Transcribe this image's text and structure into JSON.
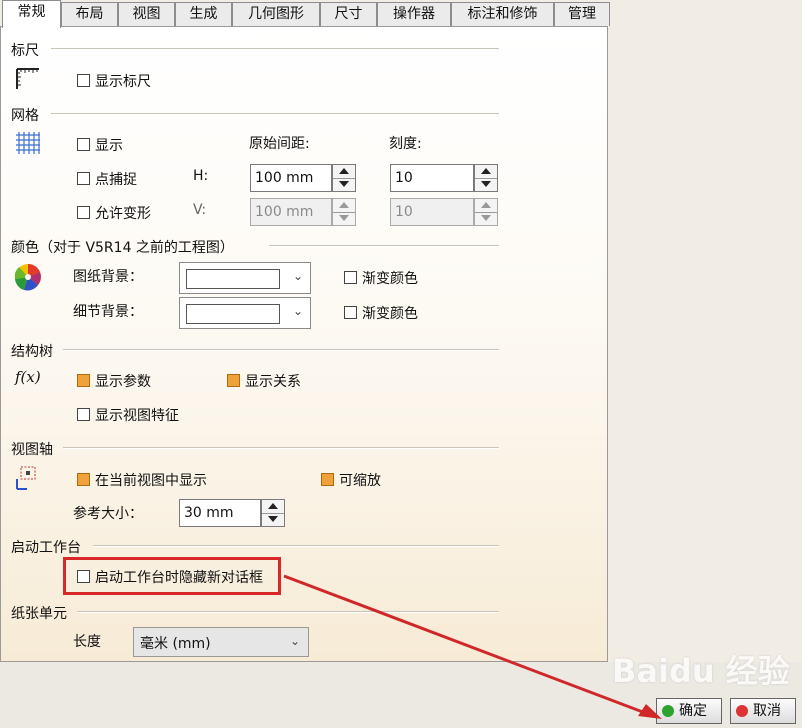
{
  "tabs": [
    "常规",
    "布局",
    "视图",
    "生成",
    "几何图形",
    "尺寸",
    "操作器",
    "标注和修饰",
    "管理"
  ],
  "ruler": {
    "section": "标尺",
    "show_label": "显示标尺",
    "show_checked": false
  },
  "grid": {
    "section": "网格",
    "show_label": "显示",
    "snap_label": "点捕捉",
    "allow_deform_label": "允许变形",
    "spacing_header": "原始间距:",
    "graduation_header": "刻度:",
    "h_label": "H:",
    "v_label": "V:",
    "h_spacing": "100 mm",
    "v_spacing": "100 mm",
    "h_graduation": "10",
    "v_graduation": "10"
  },
  "colors": {
    "section": "颜色（对于 V5R14 之前的工程图）",
    "sheet_bg_label": "图纸背景：",
    "detail_bg_label": "细节背景：",
    "gradient_label": "渐变颜色"
  },
  "tree": {
    "section": "结构树",
    "show_params_label": "显示参数",
    "show_relations_label": "显示关系",
    "show_view_features_label": "显示视图特征",
    "icon_text": "f(x)"
  },
  "view_axis": {
    "section": "视图轴",
    "show_in_current_label": "在当前视图中显示",
    "zoomable_label": "可缩放",
    "ref_size_label": "参考大小：",
    "ref_size_value": "30 mm"
  },
  "workbench": {
    "section": "启动工作台",
    "hide_dialog_label": "启动工作台时隐藏新对话框"
  },
  "paper": {
    "section": "纸张单元",
    "length_label": "长度",
    "length_value": "毫米 (mm)"
  },
  "buttons": {
    "ok": "确定",
    "cancel": "取消"
  },
  "colors_theme": {
    "checked": "#f0a23a",
    "highlight": "#d8282a",
    "arrow": "#d0282a"
  },
  "watermark": "Baidu 经验"
}
